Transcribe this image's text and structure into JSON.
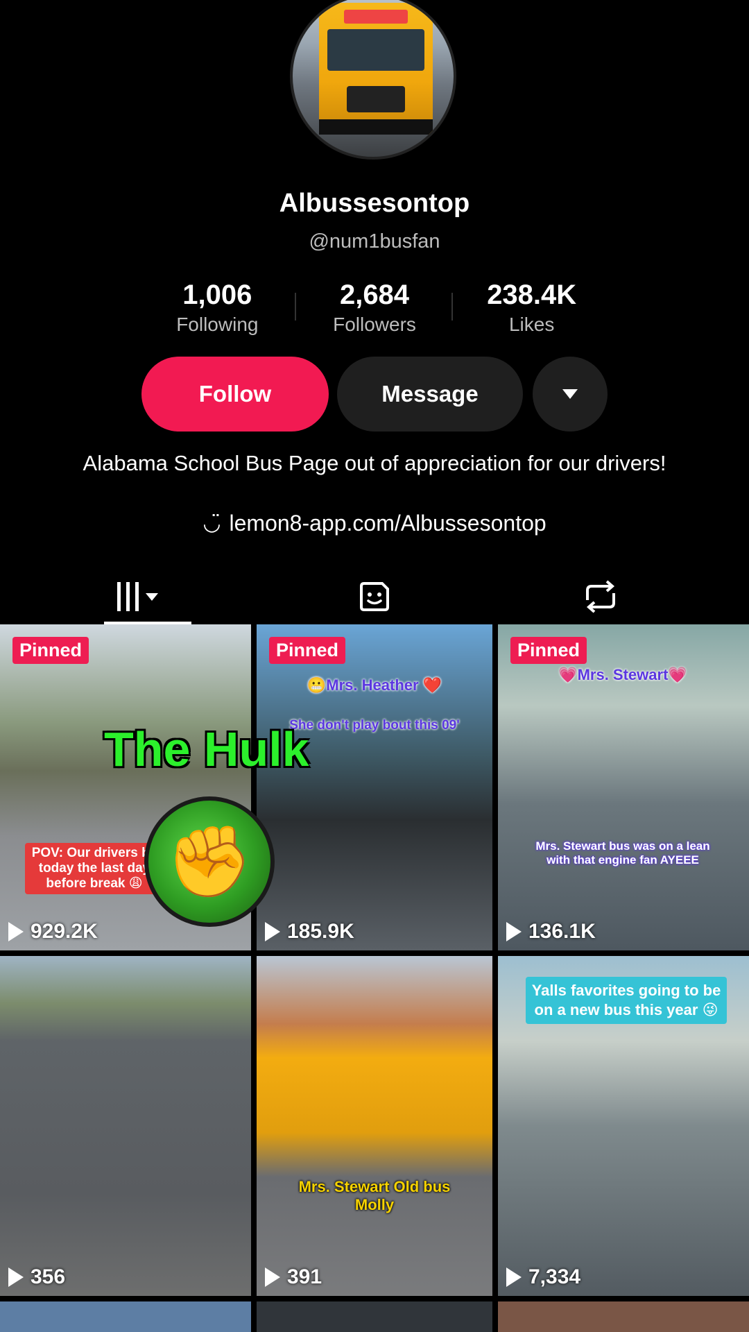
{
  "profile": {
    "display_name": "Albussesontop",
    "handle": "@num1busfan",
    "stats": [
      {
        "value": "1,006",
        "label": "Following"
      },
      {
        "value": "2,684",
        "label": "Followers"
      },
      {
        "value": "238.4K",
        "label": "Likes"
      }
    ],
    "bio": "Alabama School Bus Page out of appreciation for our drivers!",
    "link": "lemon8-app.com/Albussesontop"
  },
  "actions": {
    "follow_label": "Follow",
    "message_label": "Message",
    "more_icon": "chevron-down-icon"
  },
  "tabs": {
    "videos_icon": "grid-icon",
    "stickers_icon": "sticker-icon",
    "repost_icon": "repost-icon"
  },
  "videos": [
    {
      "pinned": "Pinned",
      "views": "929.2K",
      "caption": "POV: Our drivers bc today the last day before break 😩"
    },
    {
      "pinned": "Pinned",
      "views": "185.9K",
      "caption_top": "😬Mrs. Heather ❤️",
      "caption_sub": "She don't play bout this 09'"
    },
    {
      "pinned": "Pinned",
      "views": "136.1K",
      "caption_top": "💗Mrs. Stewart💗",
      "caption_sub": "Mrs. Stewart bus was on a lean with that engine fan AYEEE"
    },
    {
      "views": "356"
    },
    {
      "views": "391",
      "caption": "Mrs. Stewart Old bus Molly"
    },
    {
      "views": "7,334",
      "caption": "Yalls favorites going to be on a new bus this year 😜"
    }
  ],
  "overlay": {
    "hulk_text": "The Hulk"
  },
  "colors": {
    "follow_button": "#f21a52",
    "pinned_badge": "#ee1d52",
    "hulk_green": "#2cf02c"
  }
}
